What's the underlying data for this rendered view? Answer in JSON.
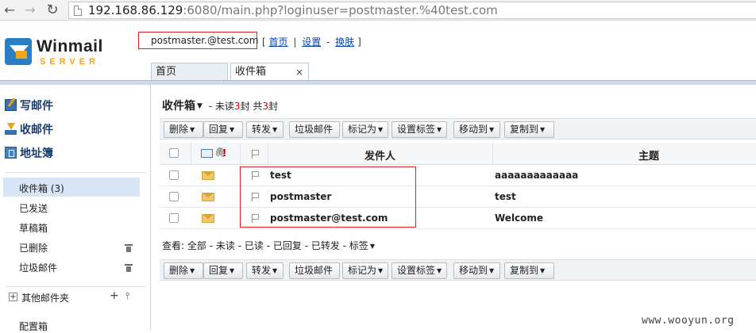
{
  "browser": {
    "url_host": "192.168.86.129",
    "url_rest": ":6080/main.php?loginuser=postmaster.%40test.com"
  },
  "logo": {
    "line1": "Winmail",
    "line2": "SERVER"
  },
  "header": {
    "username": "postmaster.@test.com",
    "links": [
      "首页",
      "设置",
      "换肤"
    ],
    "brackets": [
      "[",
      "]"
    ],
    "seps": [
      "|",
      "-"
    ]
  },
  "tabs": [
    {
      "label": "首页"
    },
    {
      "label": "收件箱",
      "close": "×"
    }
  ],
  "sidebar": {
    "actions": [
      "写邮件",
      "收邮件",
      "地址簿"
    ],
    "folders": [
      "收件箱 (3)",
      "已发送",
      "草稿箱",
      "已删除",
      "垃圾邮件"
    ],
    "other_folders": "其他邮件夹",
    "other_plus": "+",
    "other_pin": "⫯",
    "config": "配置箱"
  },
  "main": {
    "title": "收件箱",
    "summary": {
      "unread_pre": "- 未读",
      "unread": "3",
      "unread_post": "封 共",
      "total": "3",
      "total_post": "封"
    }
  },
  "toolbar": [
    {
      "label": "删除",
      "caret": true
    },
    {
      "label": "回复",
      "caret": true
    },
    {
      "label": "转发",
      "caret": true
    },
    {
      "label": "垃圾邮件",
      "caret": false
    },
    {
      "label": "标记为",
      "caret": true
    },
    {
      "label": "设置标签",
      "caret": true
    },
    {
      "label": "移动到",
      "caret": true
    },
    {
      "label": "复制到",
      "caret": true
    }
  ],
  "table": {
    "headers": {
      "sender": "发件人",
      "subject": "主题"
    },
    "rows": [
      {
        "sender": "test",
        "subject": "aaaaaaaaaaaaa"
      },
      {
        "sender": "postmaster",
        "subject": "test"
      },
      {
        "sender": "postmaster@test.com",
        "subject": "Welcome"
      }
    ]
  },
  "view": {
    "label": "查看:",
    "items": [
      "全部",
      "未读",
      "已读",
      "已回复",
      "已转发",
      "标签"
    ]
  },
  "watermark": "www.wooyun.org"
}
